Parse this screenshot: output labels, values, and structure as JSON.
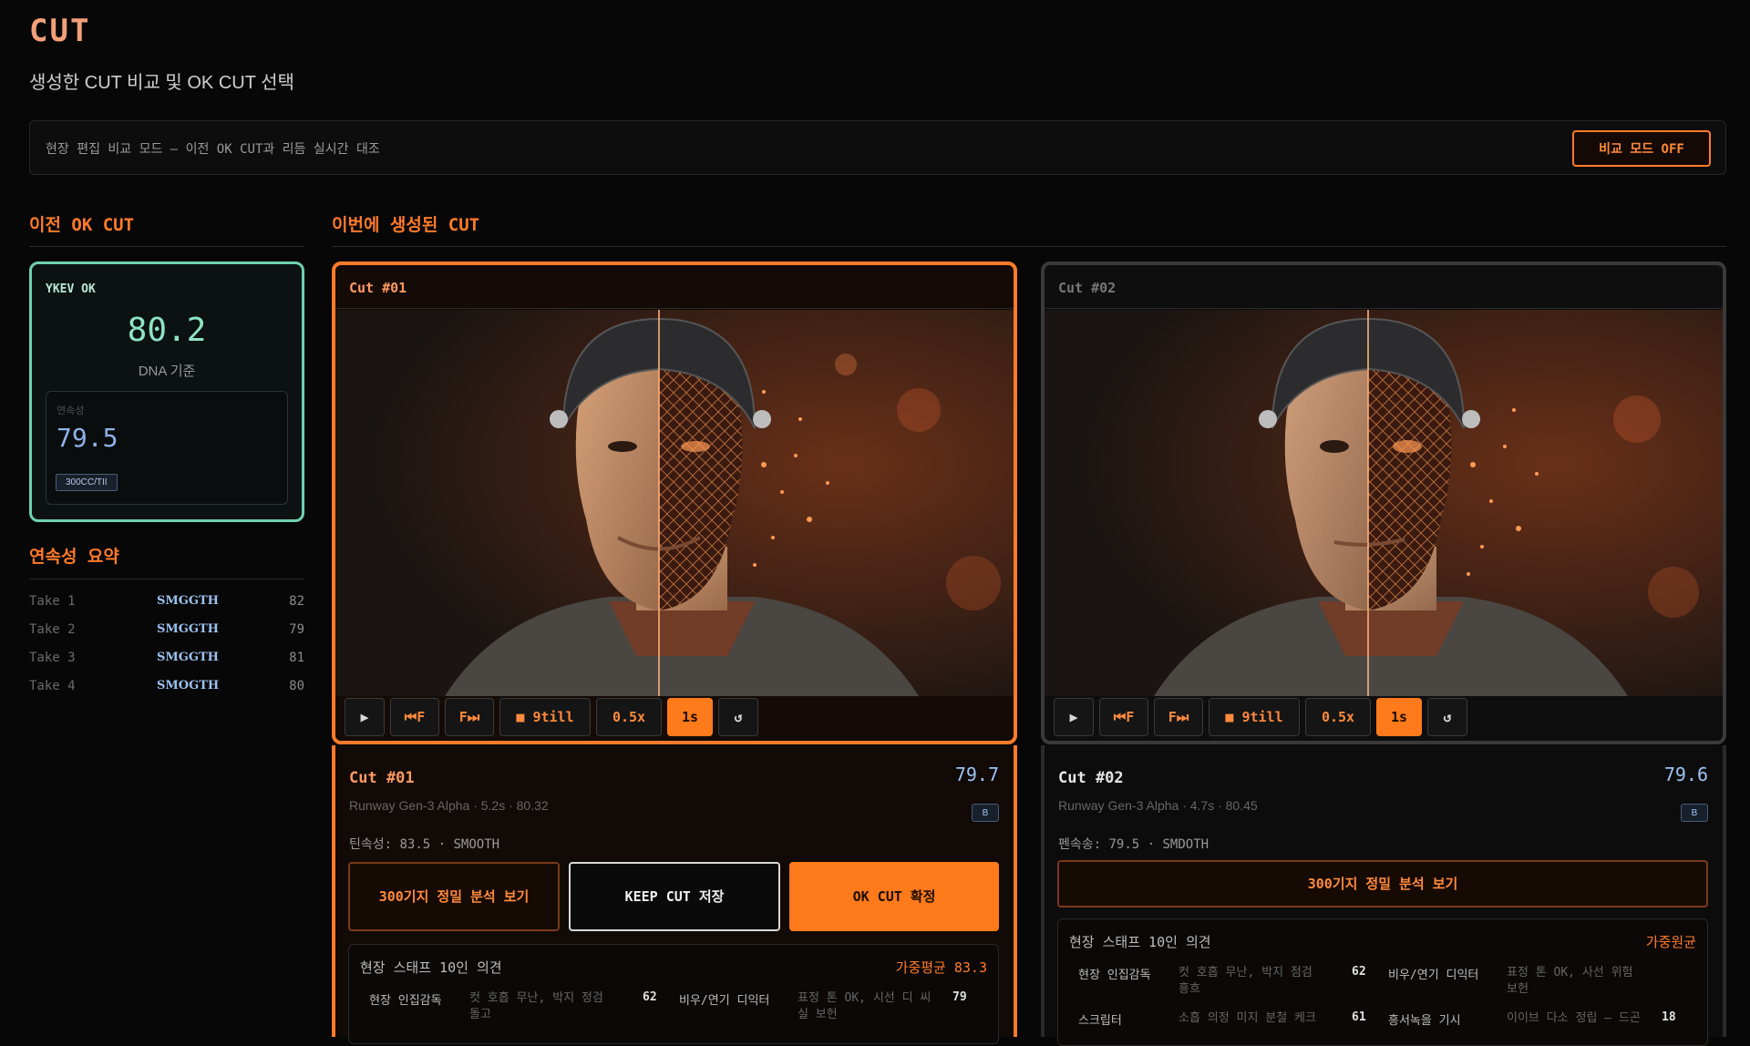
{
  "header": {
    "title": "CUT",
    "subtitle": "생성한 CUT 비교 및 OK CUT 선택"
  },
  "compare_bar": {
    "text": "현장 편집 비교 모드 — 이전 OK CUT과 리듬 실시간 대조",
    "toggle_label": "비교 모드 OFF"
  },
  "sections": {
    "previous": "이전 OK CUT",
    "current": "이번에 생성된 CUT",
    "continuity": "연속성 요약"
  },
  "previous_ok": {
    "tag": "YKEV OK",
    "score": "80.2",
    "basis": "DNA 기준",
    "sub_label": "연속성",
    "sub_value": "79.5",
    "badge": "300CC/TII"
  },
  "continuity_summary": [
    {
      "take": "Take 1",
      "status": "SMGGTH",
      "score": "82"
    },
    {
      "take": "Take 2",
      "status": "SMGGTH",
      "score": "79"
    },
    {
      "take": "Take 3",
      "status": "SMGGTH",
      "score": "81"
    },
    {
      "take": "Take 4",
      "status": "SMOGTH",
      "score": "80"
    }
  ],
  "player_controls": {
    "play": "▶",
    "prev_frame": "⏮F",
    "next_frame": "F⏭",
    "still": "■ 9till",
    "half_speed": "0.5x",
    "one_sec": "1s",
    "reset": "↺"
  },
  "cuts": [
    {
      "header": "Cut #01",
      "name": "Cut #01",
      "score": "79.7",
      "meta": "Runway Gen-3 Alpha · 5.2s · 80.32",
      "mini_badge": "B",
      "continuity": "틴속성: 83.5 · SMOOTH",
      "analyze_label": "300기지 정밀 분석 보기",
      "keep_label": "KEEP CUT 저장",
      "ok_label": "OK CUT 확정",
      "opinions_title": "현장 스태프 10인 의견",
      "opinions_avg": "가중평균 83.3",
      "opinions": [
        {
          "role": "현장 인집감독",
          "comment": "컷 호흡 무난, 박지 정검 돌고",
          "score": "62"
        },
        {
          "role": "비우/연기 디익터",
          "comment": "표정 톤 OK, 시선 디 씨실 보헌",
          "score": "79"
        }
      ]
    },
    {
      "header": "Cut #02",
      "name": "Cut #02",
      "score": "79.6",
      "meta": "Runway Gen-3 Alpha · 4.7s · 80.45",
      "mini_badge": "B",
      "continuity": "펜속송: 79.5 · SMDOTH",
      "analyze_label": "300기지 정밀 분석 보기",
      "opinions_title": "현장 스태프 10인 의견",
      "opinions_avg": "가중원균",
      "opinions": [
        {
          "role": "현장 인집감독",
          "comment": "컷 호흡 무난, 박지 점검 흥흐",
          "score": "62"
        },
        {
          "role": "비우/연기 디익터",
          "comment": "표정 톤 OK, 사선 위험 보헌",
          "score": ""
        },
        {
          "role": "스크립터",
          "comment": "소흡 의정 미지 분철 케크",
          "score": "61"
        },
        {
          "role": "흥서녹을 기시",
          "comment": "이이브 다소 정립 — 드곤",
          "score": "18"
        }
      ]
    }
  ],
  "colors": {
    "accent": "#ff7a2a",
    "previous_ok": "#6fd1b2",
    "score_blue": "#9ec3f5",
    "background": "#070707"
  }
}
